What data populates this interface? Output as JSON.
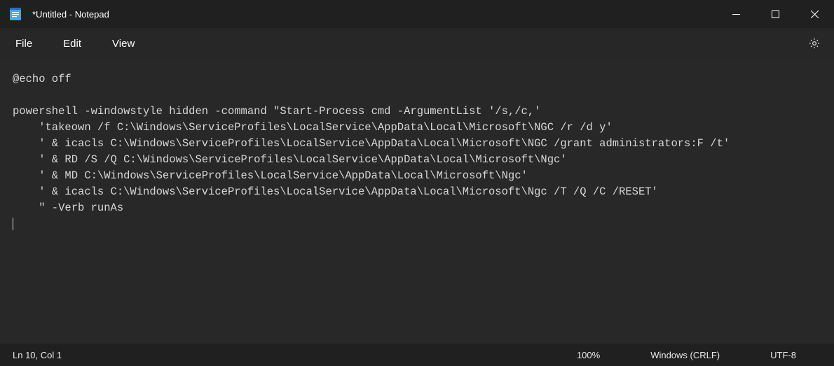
{
  "window": {
    "title": "*Untitled - Notepad"
  },
  "menu": {
    "file": "File",
    "edit": "Edit",
    "view": "View"
  },
  "editor": {
    "content": "@echo off\n\npowershell -windowstyle hidden -command \"Start-Process cmd -ArgumentList '/s,/c,'\n    'takeown /f C:\\Windows\\ServiceProfiles\\LocalService\\AppData\\Local\\Microsoft\\NGC /r /d y'\n    ' & icacls C:\\Windows\\ServiceProfiles\\LocalService\\AppData\\Local\\Microsoft\\NGC /grant administrators:F /t'\n    ' & RD /S /Q C:\\Windows\\ServiceProfiles\\LocalService\\AppData\\Local\\Microsoft\\Ngc'\n    ' & MD C:\\Windows\\ServiceProfiles\\LocalService\\AppData\\Local\\Microsoft\\Ngc'\n    ' & icacls C:\\Windows\\ServiceProfiles\\LocalService\\AppData\\Local\\Microsoft\\Ngc /T /Q /C /RESET'\n    \" -Verb runAs"
  },
  "status": {
    "position": "Ln 10, Col 1",
    "zoom": "100%",
    "line_ending": "Windows (CRLF)",
    "encoding": "UTF-8"
  }
}
